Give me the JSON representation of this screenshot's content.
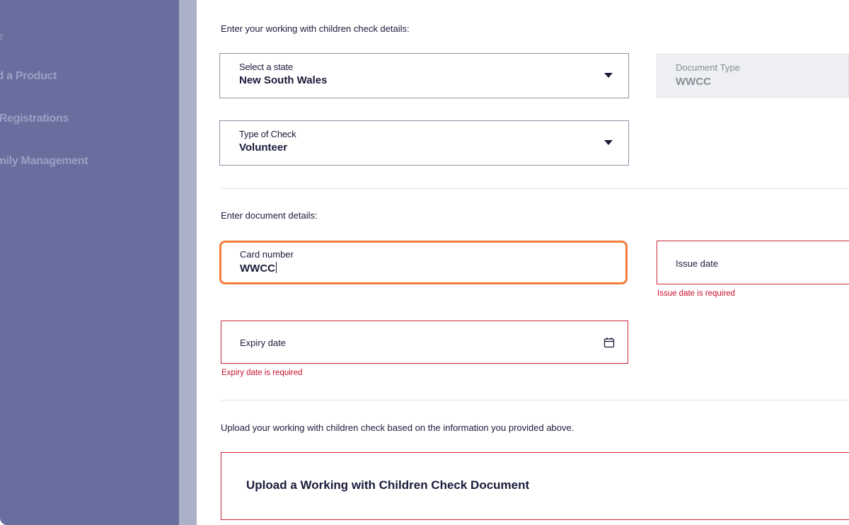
{
  "sidebar": {
    "header": "T",
    "items": [
      {
        "label": "nd a Product"
      },
      {
        "label": "y Registrations"
      },
      {
        "label": "amily Management"
      }
    ]
  },
  "wwcc": {
    "intro": "Enter your working with children check details:",
    "state_select": {
      "label": "Select a state",
      "value": "New South Wales"
    },
    "document_type": {
      "label": "Document Type",
      "value": "WWCC"
    },
    "check_type_select": {
      "label": "Type of Check",
      "value": "Volunteer"
    }
  },
  "document": {
    "intro": "Enter document details:",
    "card_number": {
      "label": "Card number",
      "value": "WWCC"
    },
    "issue_date": {
      "label": "Issue date",
      "error": "Issue date is required"
    },
    "expiry_date": {
      "label": "Expiry date",
      "error": "Expiry date is required"
    }
  },
  "upload": {
    "intro": "Upload your working with children check based on the information you provided above.",
    "title": "Upload a Working with Children Check Document"
  },
  "icons": {
    "dropdown": "chevron-down-icon",
    "calendar": "calendar-icon"
  },
  "colors": {
    "sidebar": "#686f9e",
    "focus_outline": "#f47c3c",
    "error": "#c8102e",
    "text": "#1a1b3a"
  }
}
